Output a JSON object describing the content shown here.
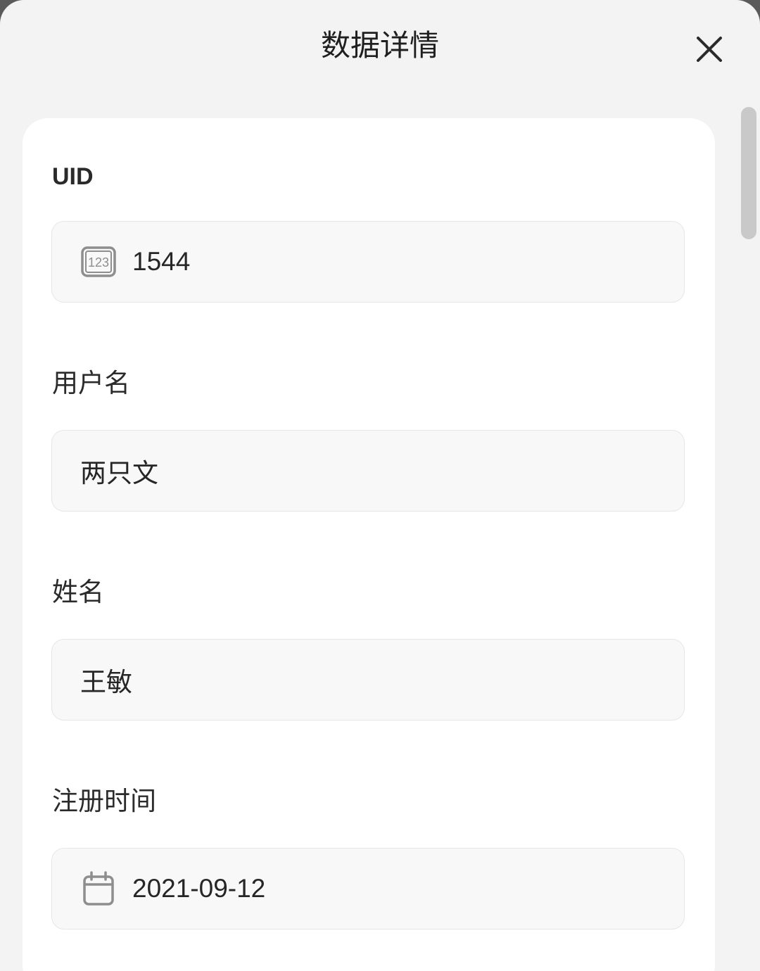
{
  "header": {
    "title": "数据详情",
    "close_icon": "close-icon"
  },
  "fields": [
    {
      "label": "UID",
      "value": "1544",
      "icon": "number-icon"
    },
    {
      "label": "用户名",
      "value": "两只文"
    },
    {
      "label": "姓名",
      "value": "王敏"
    },
    {
      "label": "注册时间",
      "value": "2021-09-12",
      "icon": "calendar-icon"
    }
  ],
  "colors": {
    "sheet_background": "#f3f3f3",
    "card_background": "#ffffff",
    "field_background": "#f8f8f8",
    "field_border": "#e6e6e6",
    "icon_gray": "#8e8e8e"
  }
}
